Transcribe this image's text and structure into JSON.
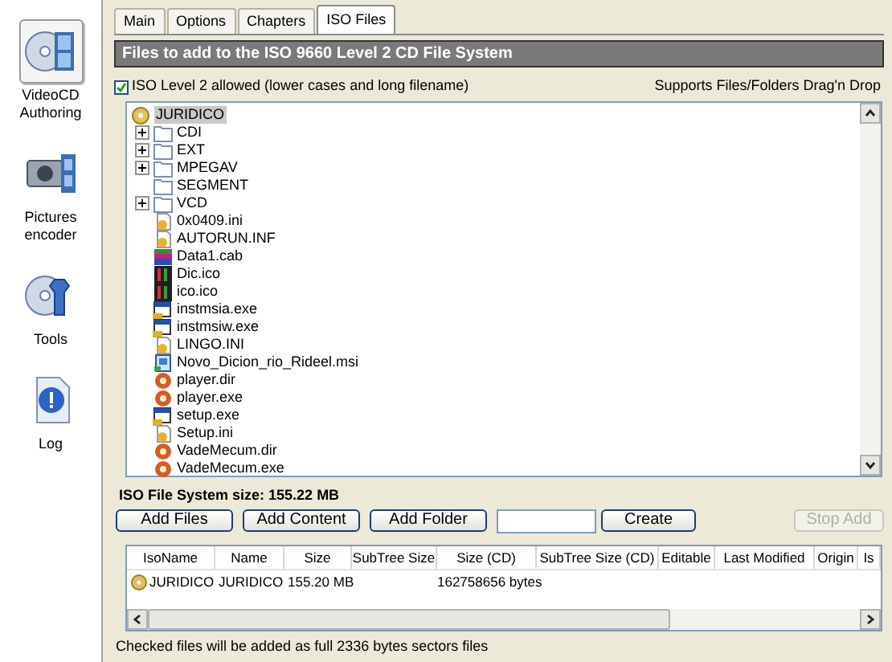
{
  "sidebar": {
    "items": [
      {
        "label": "VideoCD Authoring",
        "kind": "video",
        "selected": true
      },
      {
        "label": "Pictures encoder",
        "kind": "camera",
        "selected": false
      },
      {
        "label": "Tools",
        "kind": "tools",
        "selected": false
      },
      {
        "label": "Log",
        "kind": "log",
        "selected": false
      }
    ]
  },
  "tabs": [
    {
      "label": "Main",
      "selected": false
    },
    {
      "label": "Options",
      "selected": false
    },
    {
      "label": "Chapters",
      "selected": false
    },
    {
      "label": "ISO Files",
      "selected": true
    }
  ],
  "header": "Files to add to the ISO 9660 Level 2 CD File System",
  "iso_level_option": {
    "label": "ISO Level 2 allowed (lower cases and long filename)",
    "checked": true
  },
  "drag_drop_note": "Supports Files/Folders Drag'n Drop",
  "tree": {
    "label": "JURIDICO",
    "selected": true,
    "children": [
      {
        "label": "CDI",
        "kind": "folder",
        "expandable": true
      },
      {
        "label": "EXT",
        "kind": "folder",
        "expandable": true
      },
      {
        "label": "MPEGAV",
        "kind": "folder",
        "expandable": true
      },
      {
        "label": "SEGMENT",
        "kind": "folder",
        "expandable": false
      },
      {
        "label": "VCD",
        "kind": "folder",
        "expandable": true
      },
      {
        "label": "0x0409.ini",
        "kind": "config"
      },
      {
        "label": "AUTORUN.INF",
        "kind": "config"
      },
      {
        "label": "Data1.cab",
        "kind": "archive"
      },
      {
        "label": "Dic.ico",
        "kind": "image"
      },
      {
        "label": "ico.ico",
        "kind": "image"
      },
      {
        "label": "instmsia.exe",
        "kind": "program"
      },
      {
        "label": "instmsiw.exe",
        "kind": "program"
      },
      {
        "label": "LINGO.INI",
        "kind": "config"
      },
      {
        "label": "Novo_Dicion_rio_Rideel.msi",
        "kind": "installer"
      },
      {
        "label": "player.dir",
        "kind": "movie"
      },
      {
        "label": "player.exe",
        "kind": "movie"
      },
      {
        "label": "setup.exe",
        "kind": "program"
      },
      {
        "label": "Setup.ini",
        "kind": "config"
      },
      {
        "label": "VadeMecum.dir",
        "kind": "movie"
      },
      {
        "label": "VadeMecum.exe",
        "kind": "movie"
      }
    ]
  },
  "size_label": "ISO File System size:  155.22 MB",
  "buttons": [
    {
      "label": "Add Files",
      "disabled": false
    },
    {
      "label": "Add Content",
      "disabled": false
    },
    {
      "label": "Add Folder",
      "disabled": false
    }
  ],
  "create_button": {
    "label": "Create",
    "disabled": false
  },
  "stop_button": {
    "label": "Stop Add",
    "disabled": true
  },
  "table": {
    "columns": [
      "IsoName",
      "Name",
      "Size",
      "SubTree Size",
      "Size (CD)",
      "SubTree Size (CD)",
      "Editable",
      "Last Modified",
      "Origin",
      "Is"
    ],
    "rows": [
      {
        "iso_name": "JURIDICO",
        "name": "JURIDICO",
        "size": "155.20 MB",
        "size_cd": "162758656 bytes"
      }
    ]
  },
  "status_bar": "Checked files will be added as full 2336 bytes sectors files"
}
